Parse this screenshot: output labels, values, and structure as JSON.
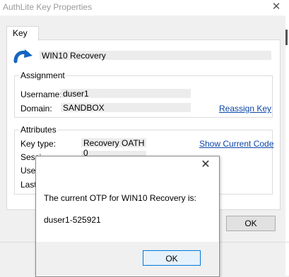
{
  "window": {
    "title": "AuthLite Key Properties",
    "close_glyph": "✕"
  },
  "tabs": [
    {
      "label": "Key",
      "active": true
    }
  ],
  "key": {
    "name": "WIN10 Recovery",
    "icon": "recovery-arrow-icon"
  },
  "assignment": {
    "title": "Assignment",
    "username_label": "Username:",
    "username_value": "duser1",
    "domain_label": "Domain:",
    "domain_value": "SANDBOX",
    "reassign_link": "Reassign Key"
  },
  "attributes": {
    "title": "Attributes",
    "keytype_label": "Key type:",
    "keytype_value": "Recovery OATH",
    "show_code_link": "Show Current Code",
    "row2_label_partial": "Sessi",
    "row2_value_partial": "0",
    "row3_label_partial": "Use",
    "row4_label_partial": "Last"
  },
  "buttons": {
    "ok": "OK"
  },
  "message_box": {
    "close_glyph": "✕",
    "message": "The current OTP for WIN10 Recovery is:",
    "code": "duser1-525921",
    "ok": "OK"
  },
  "colors": {
    "link": "#0b46a8",
    "icon_blue": "#1565c0",
    "focus_border": "#0078d7"
  }
}
